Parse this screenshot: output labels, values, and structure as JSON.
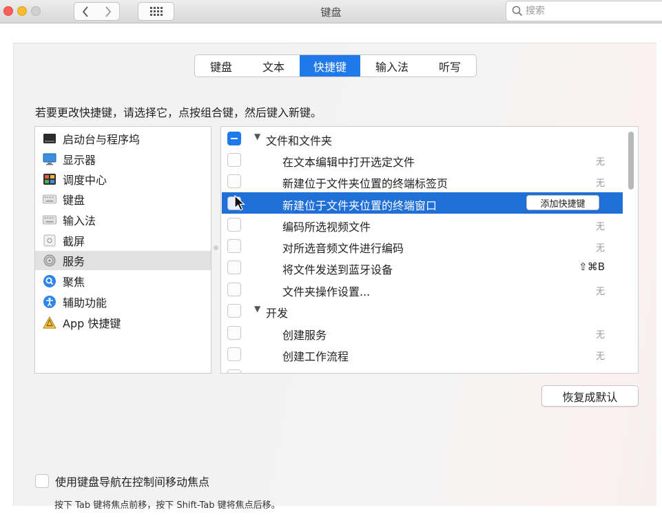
{
  "window": {
    "title": "键盘",
    "search_placeholder": "搜索"
  },
  "tabs": [
    {
      "label": "键盘",
      "selected": false
    },
    {
      "label": "文本",
      "selected": false
    },
    {
      "label": "快捷键",
      "selected": true
    },
    {
      "label": "输入法",
      "selected": false
    },
    {
      "label": "听写",
      "selected": false
    }
  ],
  "instruction": "若要更改快捷键，请选择它，点按组合键，然后键入新键。",
  "categories": [
    {
      "label": "启动台与程序坞",
      "icon": "dock-icon",
      "selected": false
    },
    {
      "label": "显示器",
      "icon": "display-icon",
      "selected": false
    },
    {
      "label": "调度中心",
      "icon": "mission-control-icon",
      "selected": false
    },
    {
      "label": "键盘",
      "icon": "keyboard-icon",
      "selected": false
    },
    {
      "label": "输入法",
      "icon": "input-method-icon",
      "selected": false
    },
    {
      "label": "截屏",
      "icon": "screenshot-icon",
      "selected": false
    },
    {
      "label": "服务",
      "icon": "services-gear-icon",
      "selected": true
    },
    {
      "label": "聚焦",
      "icon": "spotlight-icon",
      "selected": false
    },
    {
      "label": "辅助功能",
      "icon": "accessibility-icon",
      "selected": false
    },
    {
      "label": "App 快捷键",
      "icon": "app-shortcuts-icon",
      "selected": false
    }
  ],
  "shortcuts": {
    "group1": {
      "label": "文件和文件夹"
    },
    "rows1": [
      {
        "label": "在文本编辑中打开选定文件",
        "key": "无"
      },
      {
        "label": "新建位于文件夹位置的终端标签页",
        "key": "无"
      },
      {
        "label": "新建位于文件夹位置的终端窗口",
        "key": "",
        "selected": true
      },
      {
        "label": "编码所选视频文件",
        "key": "无"
      },
      {
        "label": "对所选音频文件进行编码",
        "key": "无"
      },
      {
        "label": "将文件发送到蓝牙设备",
        "key": "⇧⌘B"
      },
      {
        "label": "文件夹操作设置...",
        "key": "无"
      }
    ],
    "group2": {
      "label": "开发"
    },
    "rows2": [
      {
        "label": "创建服务",
        "key": "无"
      },
      {
        "label": "创建工作流程",
        "key": "无"
      }
    ],
    "add_shortcut_label": "添加快捷键"
  },
  "restore_button": "恢复成默认",
  "keyboard_navigation": {
    "label": "使用键盘导航在控制间移动焦点",
    "checked": false,
    "hint": "按下 Tab 键将焦点前移，按下 Shift-Tab 键将焦点后移。"
  },
  "colors": {
    "accent": "#1f79e8",
    "selection": "#1f6fd6"
  }
}
